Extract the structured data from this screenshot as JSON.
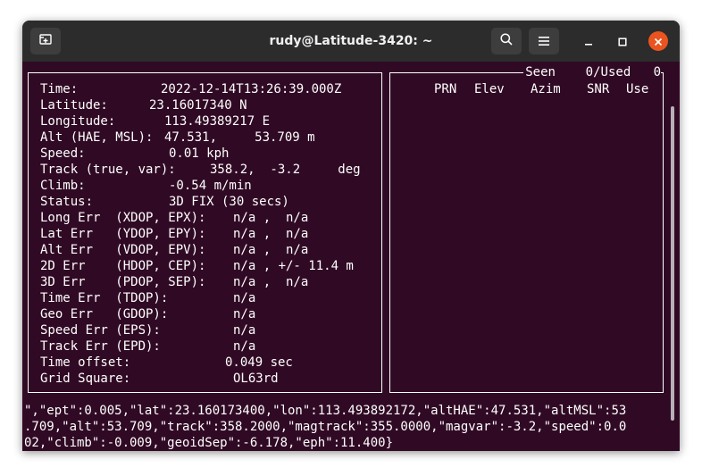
{
  "window": {
    "title": "rudy@Latitude-3420: ~"
  },
  "icons": {
    "new_tab": "new-tab-icon",
    "search": "search-icon",
    "menu": "hamburger-menu-icon",
    "minimize": "minimize-icon",
    "maximize": "maximize-icon",
    "close": "close-icon"
  },
  "colors": {
    "terminal_bg": "#300a24",
    "titlebar_bg": "#2c2c2c",
    "close_btn": "#e95420",
    "text": "#ffffff"
  },
  "gps": {
    "fields": [
      {
        "label": "Time:",
        "value": "2022-12-14T13:26:39.000Z"
      },
      {
        "label": "Latitude:",
        "value": "23.16017340 N"
      },
      {
        "label": "Longitude:",
        "value": "113.49389217 E"
      },
      {
        "label": "Alt (HAE, MSL):",
        "value": "47.531,     53.709 m"
      },
      {
        "label": "Speed:",
        "value": "0.01 kph"
      },
      {
        "label": "Track (true, var):",
        "value": "358.2,  -3.2     deg"
      },
      {
        "label": "Climb:",
        "value": "-0.54 m/min"
      },
      {
        "label": "Status:",
        "value": "3D FIX (30 secs)"
      },
      {
        "label": "Long Err  (XDOP, EPX):",
        "value": "n/a ,  n/a"
      },
      {
        "label": "Lat Err   (YDOP, EPY):",
        "value": "n/a ,  n/a"
      },
      {
        "label": "Alt Err   (VDOP, EPV):",
        "value": "n/a ,  n/a"
      },
      {
        "label": "2D Err    (HDOP, CEP):",
        "value": "n/a , +/- 11.4 m"
      },
      {
        "label": "3D Err    (PDOP, SEP):",
        "value": "n/a ,  n/a"
      },
      {
        "label": "Time Err  (TDOP):",
        "value": "n/a"
      },
      {
        "label": "Geo Err   (GDOP):",
        "value": "n/a"
      },
      {
        "label": "Speed Err (EPS):",
        "value": "n/a"
      },
      {
        "label": "Track Err (EPD):",
        "value": "n/a"
      },
      {
        "label": "Time offset:",
        "value": "0.049 sec"
      },
      {
        "label": "Grid Square:",
        "value": "OL63rd"
      }
    ]
  },
  "satellites": {
    "seen_label": "Seen",
    "seen_value": "0",
    "used_label": "/Used",
    "used_value": "0",
    "columns": [
      "PRN",
      "Elev",
      "Azim",
      "SNR",
      "Use"
    ]
  },
  "json_output": [
    "\",\"ept\":0.005,\"lat\":23.160173400,\"lon\":113.493892172,\"altHAE\":47.531,\"altMSL\":53",
    ".709,\"alt\":53.709,\"track\":358.2000,\"magtrack\":355.0000,\"magvar\":-3.2,\"speed\":0.0",
    "02,\"climb\":-0.009,\"geoidSep\":-6.178,\"eph\":11.400}"
  ]
}
